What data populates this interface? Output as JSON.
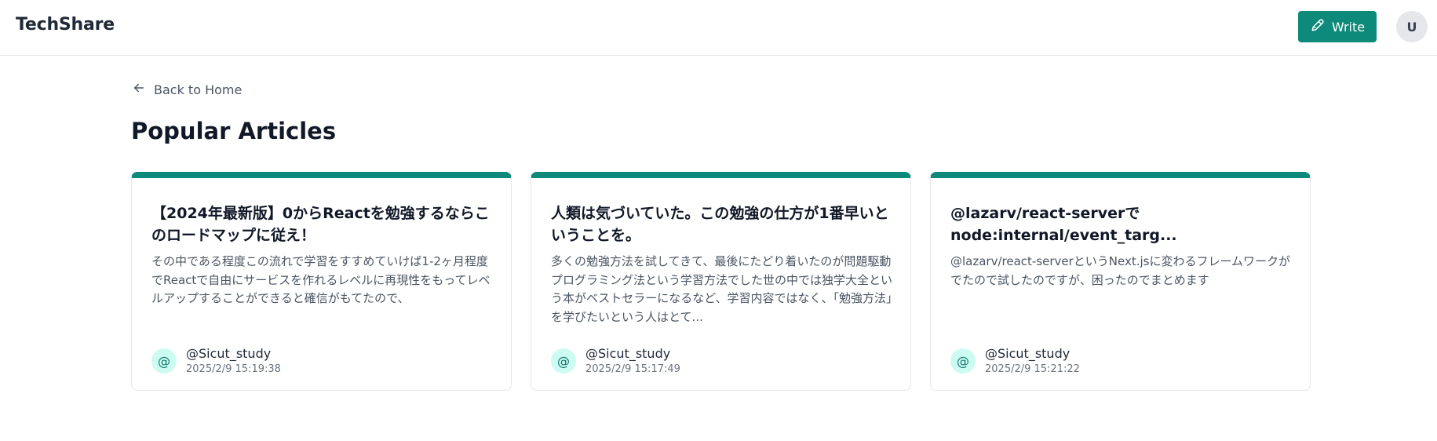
{
  "header": {
    "brand": "TechShare",
    "write_label": "Write",
    "avatar_initial": "U"
  },
  "nav": {
    "back_label": "Back to Home"
  },
  "page": {
    "title": "Popular Articles"
  },
  "articles": [
    {
      "title": "【2024年最新版】0からReactを勉強するならこのロードマップに従え！",
      "excerpt": "その中である程度この流れで学習をすすめていけば1-2ヶ月程度でReactで自由にサービスを作れるレベルに再現性をもってレベルアップすることができると確信がもてたので、",
      "author": "@Sicut_study",
      "date": "2025/2/9 15:19:38",
      "author_icon": "@"
    },
    {
      "title": "人類は気づいていた。この勉強の仕方が1番早いということを。",
      "excerpt": "多くの勉強方法を試してきて、最後にたどり着いたのが問題駆動プログラミング法という学習方法でした世の中では独学大全という本がベストセラーになるなど、学習内容ではなく、「勉強方法」を学びたいという人はとて...",
      "author": "@Sicut_study",
      "date": "2025/2/9 15:17:49",
      "author_icon": "@"
    },
    {
      "title": "@lazarv/react-serverでnode:internal/event_targ...",
      "excerpt": "@lazarv/react-serverというNext.jsに変わるフレームワークがでたので試したのですが、困ったのでまとめます",
      "author": "@Sicut_study",
      "date": "2025/2/9 15:21:22",
      "author_icon": "@"
    }
  ],
  "icons": {
    "write": "pen-icon",
    "back": "arrow-left-icon"
  },
  "colors": {
    "accent": "#0e8a7a",
    "avatar_bg": "#e5e7eb",
    "author_icon_bg": "#ccfbf1"
  }
}
